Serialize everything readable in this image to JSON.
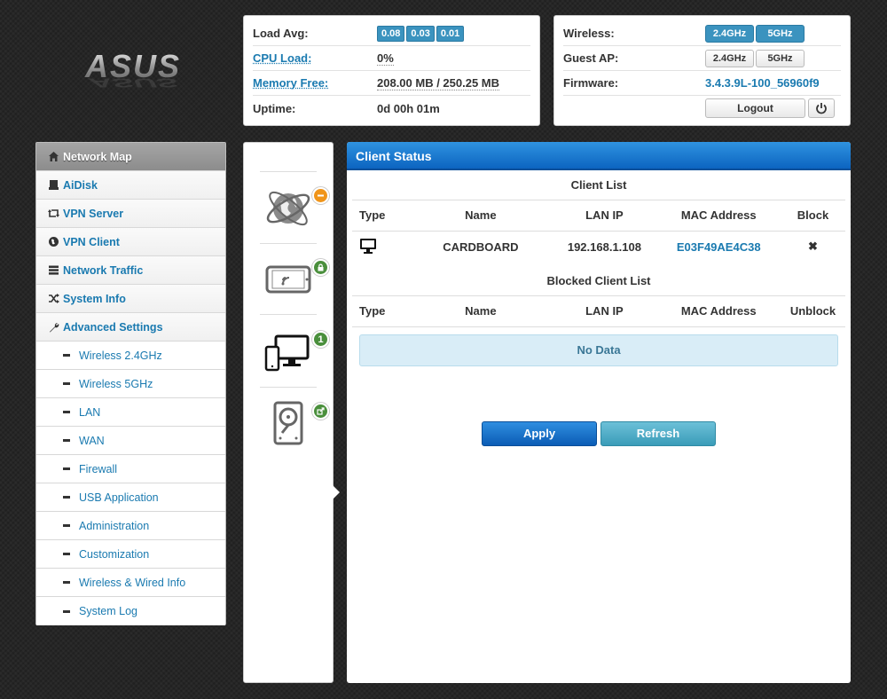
{
  "logo": {
    "text": "ASUS"
  },
  "stats": {
    "load_avg": {
      "label": "Load Avg:",
      "values": [
        "0.08",
        "0.03",
        "0.01"
      ]
    },
    "cpu": {
      "label": "CPU Load:",
      "value": "0%"
    },
    "memory": {
      "label": "Memory Free:",
      "value": "208.00 MB / 250.25 MB"
    },
    "uptime": {
      "label": "Uptime:",
      "value": "0d 00h 01m"
    }
  },
  "wifi": {
    "wireless": {
      "label": "Wireless:",
      "btn_24": "2.4GHz",
      "btn_5": "5GHz"
    },
    "guest": {
      "label": "Guest AP:",
      "btn_24": "2.4GHz",
      "btn_5": "5GHz"
    },
    "firmware": {
      "label": "Firmware:",
      "value": "3.4.3.9L-100_56960f9"
    },
    "logout": "Logout"
  },
  "sidebar": {
    "items": [
      {
        "label": "Network Map",
        "icon": "home-icon"
      },
      {
        "label": "AiDisk",
        "icon": "drive-icon"
      },
      {
        "label": "VPN Server",
        "icon": "retweet-icon"
      },
      {
        "label": "VPN Client",
        "icon": "globe-icon"
      },
      {
        "label": "Network Traffic",
        "icon": "server-icon"
      },
      {
        "label": "System Info",
        "icon": "shuffle-icon"
      },
      {
        "label": "Advanced Settings",
        "icon": "wrench-icon"
      }
    ],
    "sub_items": [
      "Wireless 2.4GHz",
      "Wireless 5GHz",
      "LAN",
      "WAN",
      "Firewall",
      "USB Application",
      "Administration",
      "Customization",
      "Wireless & Wired Info",
      "System Log"
    ]
  },
  "devices": {
    "client_count": "1"
  },
  "main": {
    "title": "Client Status",
    "client_list": {
      "title": "Client List",
      "headers": [
        "Type",
        "Name",
        "LAN IP",
        "MAC Address",
        "Block"
      ],
      "rows": [
        {
          "name": "CARDBOARD",
          "ip": "192.168.1.108",
          "mac": "E03F49AE4C38",
          "action": "✖"
        }
      ]
    },
    "blocked_list": {
      "title": "Blocked Client List",
      "headers": [
        "Type",
        "Name",
        "LAN IP",
        "MAC Address",
        "Unblock"
      ],
      "empty": "No Data"
    },
    "apply": "Apply",
    "refresh": "Refresh"
  },
  "colors": {
    "accent": "#1a7ab0",
    "header_blue": "#0c64c0",
    "badge_orange": "#f0951a",
    "badge_green": "#4a8f3c"
  }
}
